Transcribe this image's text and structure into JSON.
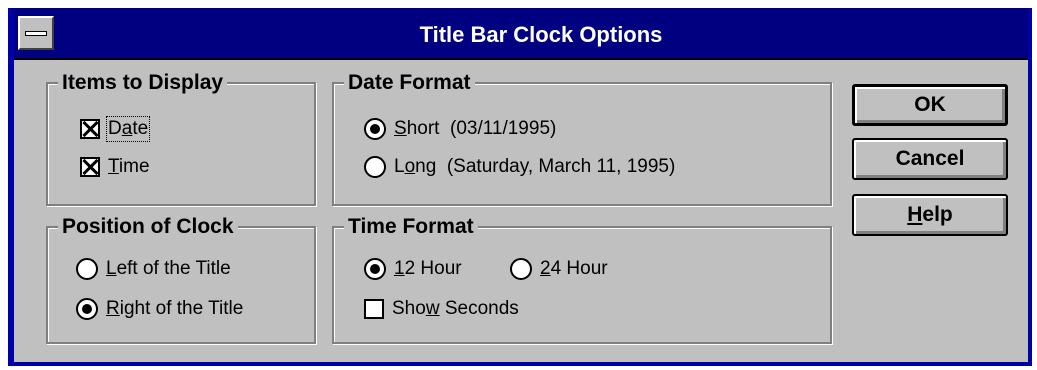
{
  "window": {
    "title": "Title Bar Clock Options"
  },
  "items_to_display": {
    "title": "Items to Display",
    "date": {
      "prefix": "D",
      "access": "a",
      "suffix": "te",
      "checked": true
    },
    "time": {
      "access": "T",
      "suffix": "ime",
      "checked": true
    }
  },
  "position_of_clock": {
    "title": "Position of Clock",
    "left": {
      "access": "L",
      "suffix": "eft of the Title",
      "selected": false
    },
    "right": {
      "access": "R",
      "suffix": "ight of the Title",
      "selected": true
    }
  },
  "date_format": {
    "title": "Date Format",
    "short": {
      "access": "S",
      "suffix": "hort",
      "example": "(03/11/1995)",
      "selected": true
    },
    "long": {
      "prefix": "L",
      "access": "o",
      "suffix": "ng",
      "example": "(Saturday, March 11, 1995)",
      "selected": false
    }
  },
  "time_format": {
    "title": "Time Format",
    "h12": {
      "access": "1",
      "suffix": "2 Hour",
      "selected": true
    },
    "h24": {
      "access": "2",
      "suffix": "4 Hour",
      "selected": false
    },
    "seconds": {
      "prefix": "Sho",
      "access": "w",
      "suffix": " Seconds",
      "checked": false
    }
  },
  "buttons": {
    "ok": "OK",
    "cancel": "Cancel",
    "help": {
      "access": "H",
      "suffix": "elp"
    }
  }
}
